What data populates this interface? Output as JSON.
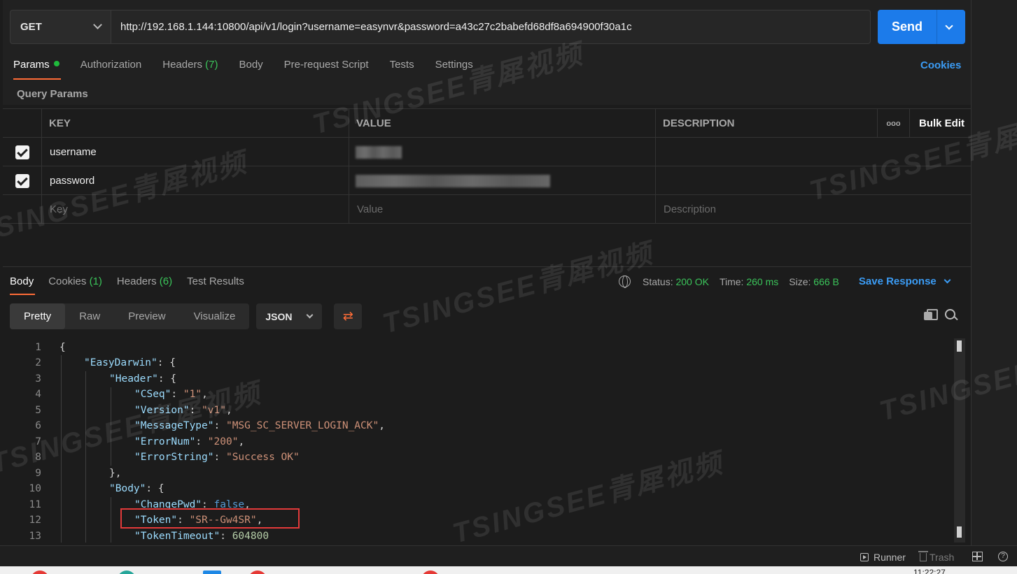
{
  "request": {
    "method": "GET",
    "url": "http://192.168.1.144:10800/api/v1/login?username=easynvr&password=a43c27c2babefd68df8a694900f30a1c",
    "send_label": "Send"
  },
  "request_tabs": {
    "params": "Params",
    "authorization": "Authorization",
    "headers": "Headers",
    "headers_count": "(7)",
    "body": "Body",
    "pre_request": "Pre-request Script",
    "tests": "Tests",
    "settings": "Settings",
    "cookies": "Cookies"
  },
  "query_params": {
    "title": "Query Params",
    "columns": {
      "key": "KEY",
      "value": "VALUE",
      "description": "DESCRIPTION",
      "bulk_edit": "Bulk Edit",
      "more": "ooo"
    },
    "rows": [
      {
        "key": "username"
      },
      {
        "key": "password"
      }
    ],
    "placeholders": {
      "key": "Key",
      "value": "Value",
      "description": "Description"
    }
  },
  "response_tabs": {
    "body": "Body",
    "cookies": "Cookies",
    "cookies_count": "(1)",
    "headers": "Headers",
    "headers_count": "(6)",
    "test_results": "Test Results"
  },
  "response_status": {
    "status_label": "Status:",
    "status_value": "200 OK",
    "time_label": "Time:",
    "time_value": "260 ms",
    "size_label": "Size:",
    "size_value": "666 B",
    "save_response": "Save Response"
  },
  "view_modes": {
    "pretty": "Pretty",
    "raw": "Raw",
    "preview": "Preview",
    "visualize": "Visualize",
    "format": "JSON"
  },
  "code": {
    "line_numbers": [
      "1",
      "2",
      "3",
      "4",
      "5",
      "6",
      "7",
      "8",
      "9",
      "10",
      "11",
      "12",
      "13"
    ],
    "l1": "{",
    "l2_key": "\"EasyDarwin\"",
    "l2_rest": ": {",
    "l3_key": "\"Header\"",
    "l3_rest": ": {",
    "l4_key": "\"CSeq\"",
    "l4_val": "\"1\"",
    "l5_key": "\"Version\"",
    "l5_val": "\"v1\"",
    "l6_key": "\"MessageType\"",
    "l6_val": "\"MSG_SC_SERVER_LOGIN_ACK\"",
    "l7_key": "\"ErrorNum\"",
    "l7_val": "\"200\"",
    "l8_key": "\"ErrorString\"",
    "l8_val": "\"Success OK\"",
    "l9": "},",
    "l10_key": "\"Body\"",
    "l10_rest": ": {",
    "l11_key": "\"ChangePwd\"",
    "l11_val": "false",
    "l12_key": "\"Token\"",
    "l12_val": "\"SR--Gw4SR\"",
    "l13_key": "\"TokenTimeout\"",
    "l13_val": "604800"
  },
  "footer": {
    "runner": "Runner",
    "trash": "Trash",
    "help": "?",
    "clock": "11:22:27"
  },
  "watermark": {
    "text": "TSINGSEE青犀视频"
  },
  "colors": {
    "accent_blue": "#1c7bea",
    "tab_underline": "#ff6c37",
    "success_green": "#3bc45a",
    "highlight_red": "#e23a3a"
  }
}
